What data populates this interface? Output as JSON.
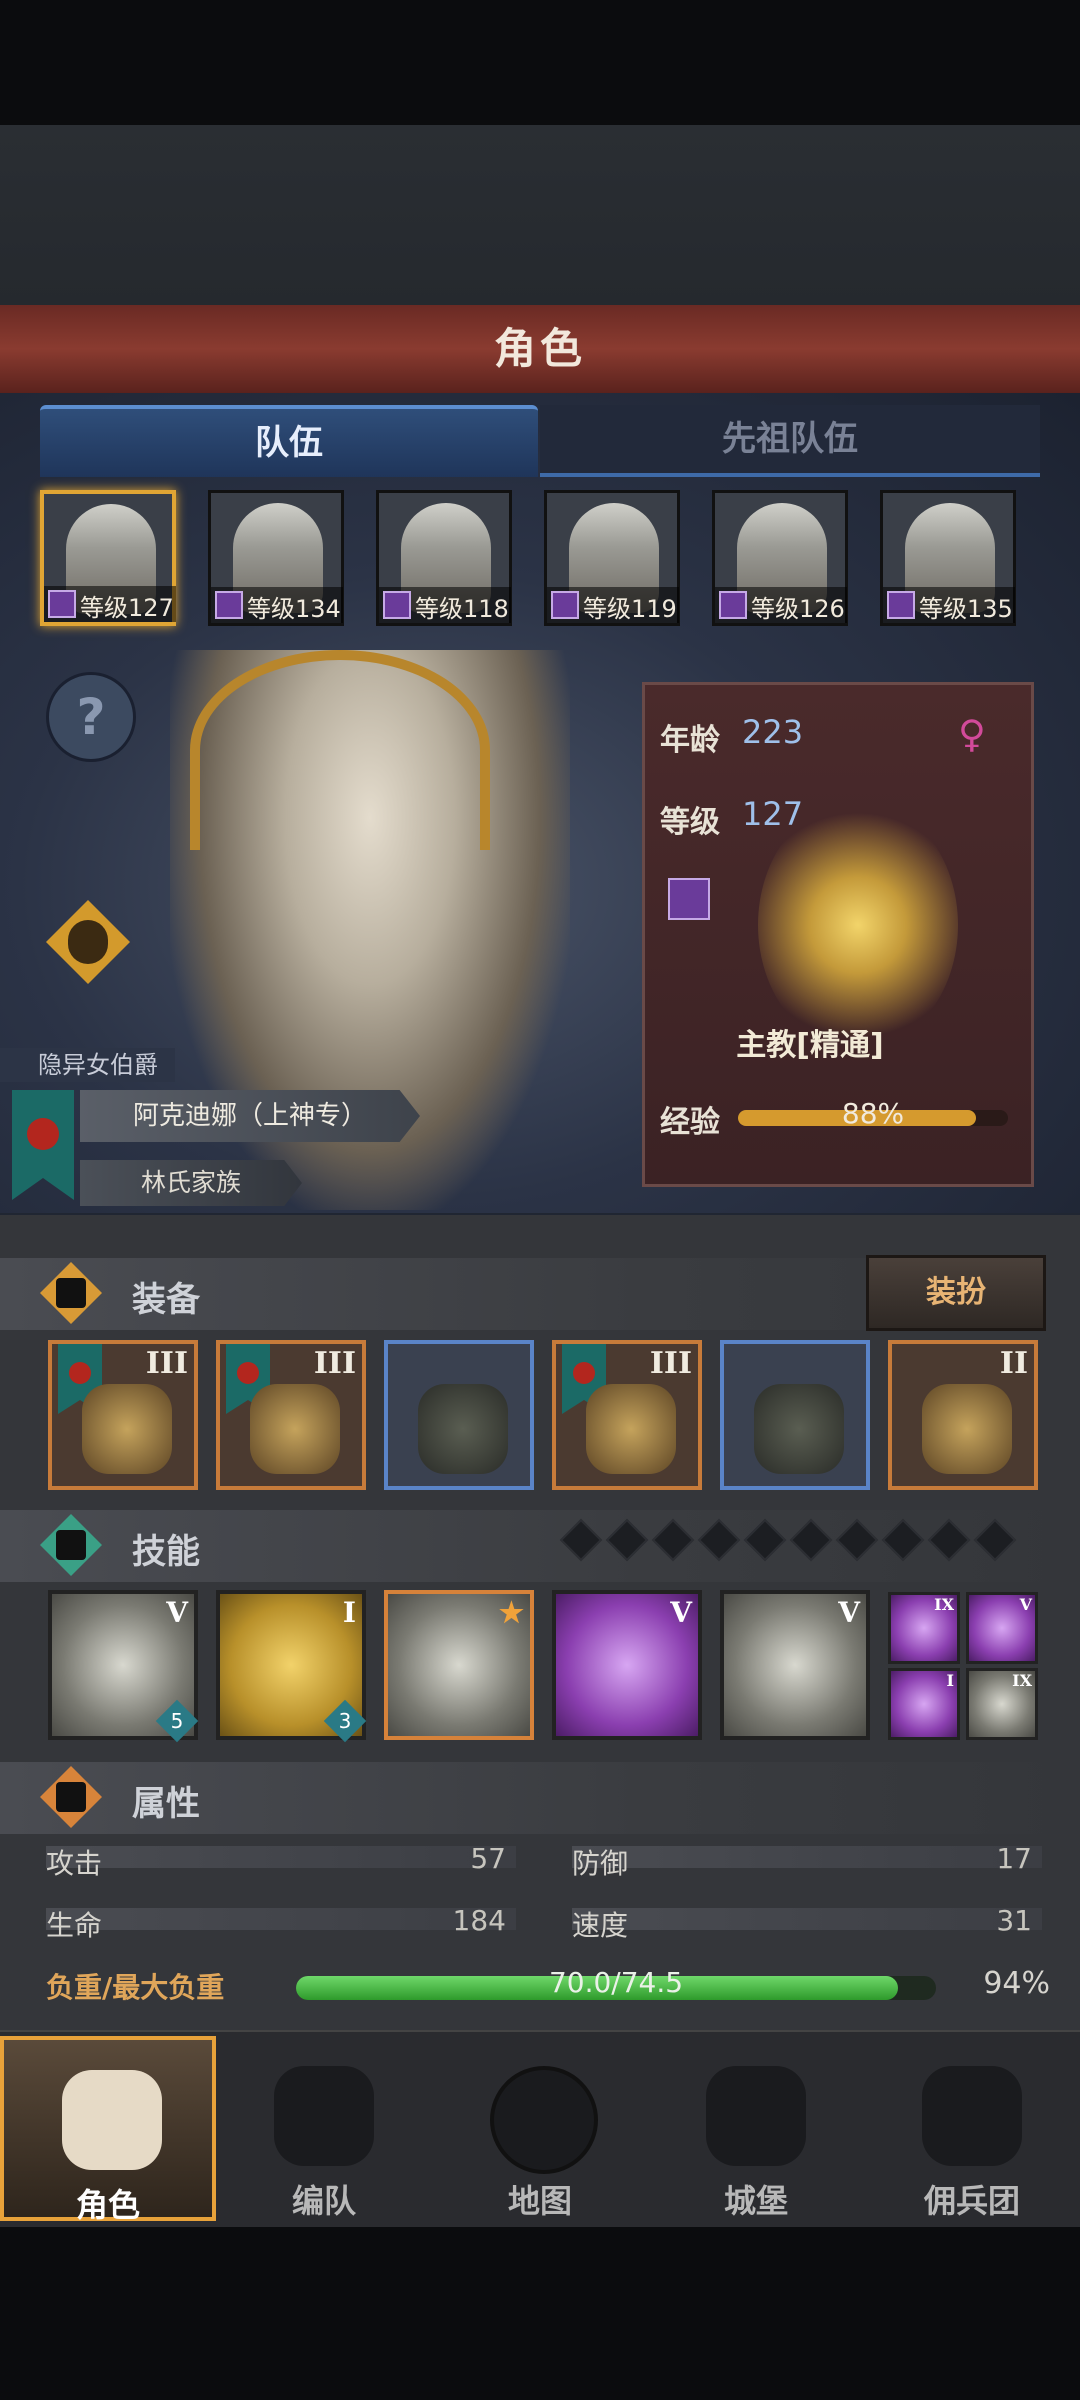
{
  "header": {
    "title": "角色"
  },
  "tabs": [
    {
      "label": "队伍"
    },
    {
      "label": "先祖队伍"
    }
  ],
  "roster": [
    {
      "level_text": "等级127",
      "selected": true
    },
    {
      "level_text": "等级134"
    },
    {
      "level_text": "等级118"
    },
    {
      "level_text": "等级119"
    },
    {
      "level_text": "等级126"
    },
    {
      "level_text": "等级135"
    }
  ],
  "hero": {
    "title": "隐异女伯爵",
    "name": "阿克迪娜（上神专）",
    "family": "林氏家族",
    "age_label": "年龄",
    "age": "223",
    "level_label": "等级",
    "level": "127",
    "gender_icon": "female-icon",
    "class_name": "主教[精通]",
    "exp_label": "经验",
    "exp_text": "88%",
    "exp_percent": 88
  },
  "equipment": {
    "label": "装备",
    "dress_button": "装扮",
    "items": [
      {
        "tier": "III",
        "flag": true,
        "rarity": "orange",
        "icon": "dragon-weapon-icon"
      },
      {
        "tier": "III",
        "flag": true,
        "rarity": "orange",
        "icon": "eye-shield-icon"
      },
      {
        "tier": "",
        "flag": false,
        "rarity": "blue",
        "icon": "hood-icon"
      },
      {
        "tier": "III",
        "flag": true,
        "rarity": "orange",
        "icon": "armor-icon"
      },
      {
        "tier": "",
        "flag": false,
        "rarity": "blue",
        "icon": "boots-icon"
      },
      {
        "tier": "II",
        "flag": false,
        "rarity": "orange",
        "icon": "bat-amulet-icon"
      }
    ]
  },
  "skills": {
    "label": "技能",
    "slots_total": 10,
    "items": [
      {
        "tier": "V",
        "count": "5",
        "style": "silver",
        "icon": "staff-summon-icon"
      },
      {
        "tier": "I",
        "count": "3",
        "style": "gold",
        "icon": "holy-shield-icon"
      },
      {
        "tier": "",
        "count": "",
        "style": "silver-orange",
        "icon": "crystal-summon-icon"
      },
      {
        "tier": "V",
        "count": "",
        "style": "purple",
        "icon": "crystal-hand-icon"
      },
      {
        "tier": "V",
        "count": "",
        "style": "silver",
        "icon": "crystal-hand-icon"
      }
    ],
    "mini": [
      {
        "tier": "IX",
        "style": "purple",
        "icon": "burst-icon"
      },
      {
        "tier": "V",
        "style": "purple",
        "icon": "wand-icon"
      },
      {
        "tier": "I",
        "style": "purple",
        "icon": "target-icon"
      },
      {
        "tier": "IX",
        "style": "silver",
        "icon": "explosion-icon"
      }
    ]
  },
  "attributes": {
    "label": "属性",
    "stats": [
      {
        "label": "攻击",
        "value": "57"
      },
      {
        "label": "防御",
        "value": "17"
      },
      {
        "label": "生命",
        "value": "184"
      },
      {
        "label": "速度",
        "value": "31"
      }
    ],
    "load_label": "负重/最大负重",
    "load_text": "70.0/74.5",
    "load_percent_text": "94%",
    "load_percent": 94
  },
  "nav": [
    {
      "label": "角色",
      "active": true,
      "icon": "knight-icon"
    },
    {
      "label": "编队",
      "icon": "helmet-icon"
    },
    {
      "label": "地图",
      "icon": "compass-map-icon"
    },
    {
      "label": "城堡",
      "icon": "castle-icon"
    },
    {
      "label": "佣兵团",
      "icon": "mercenary-icon"
    }
  ]
}
